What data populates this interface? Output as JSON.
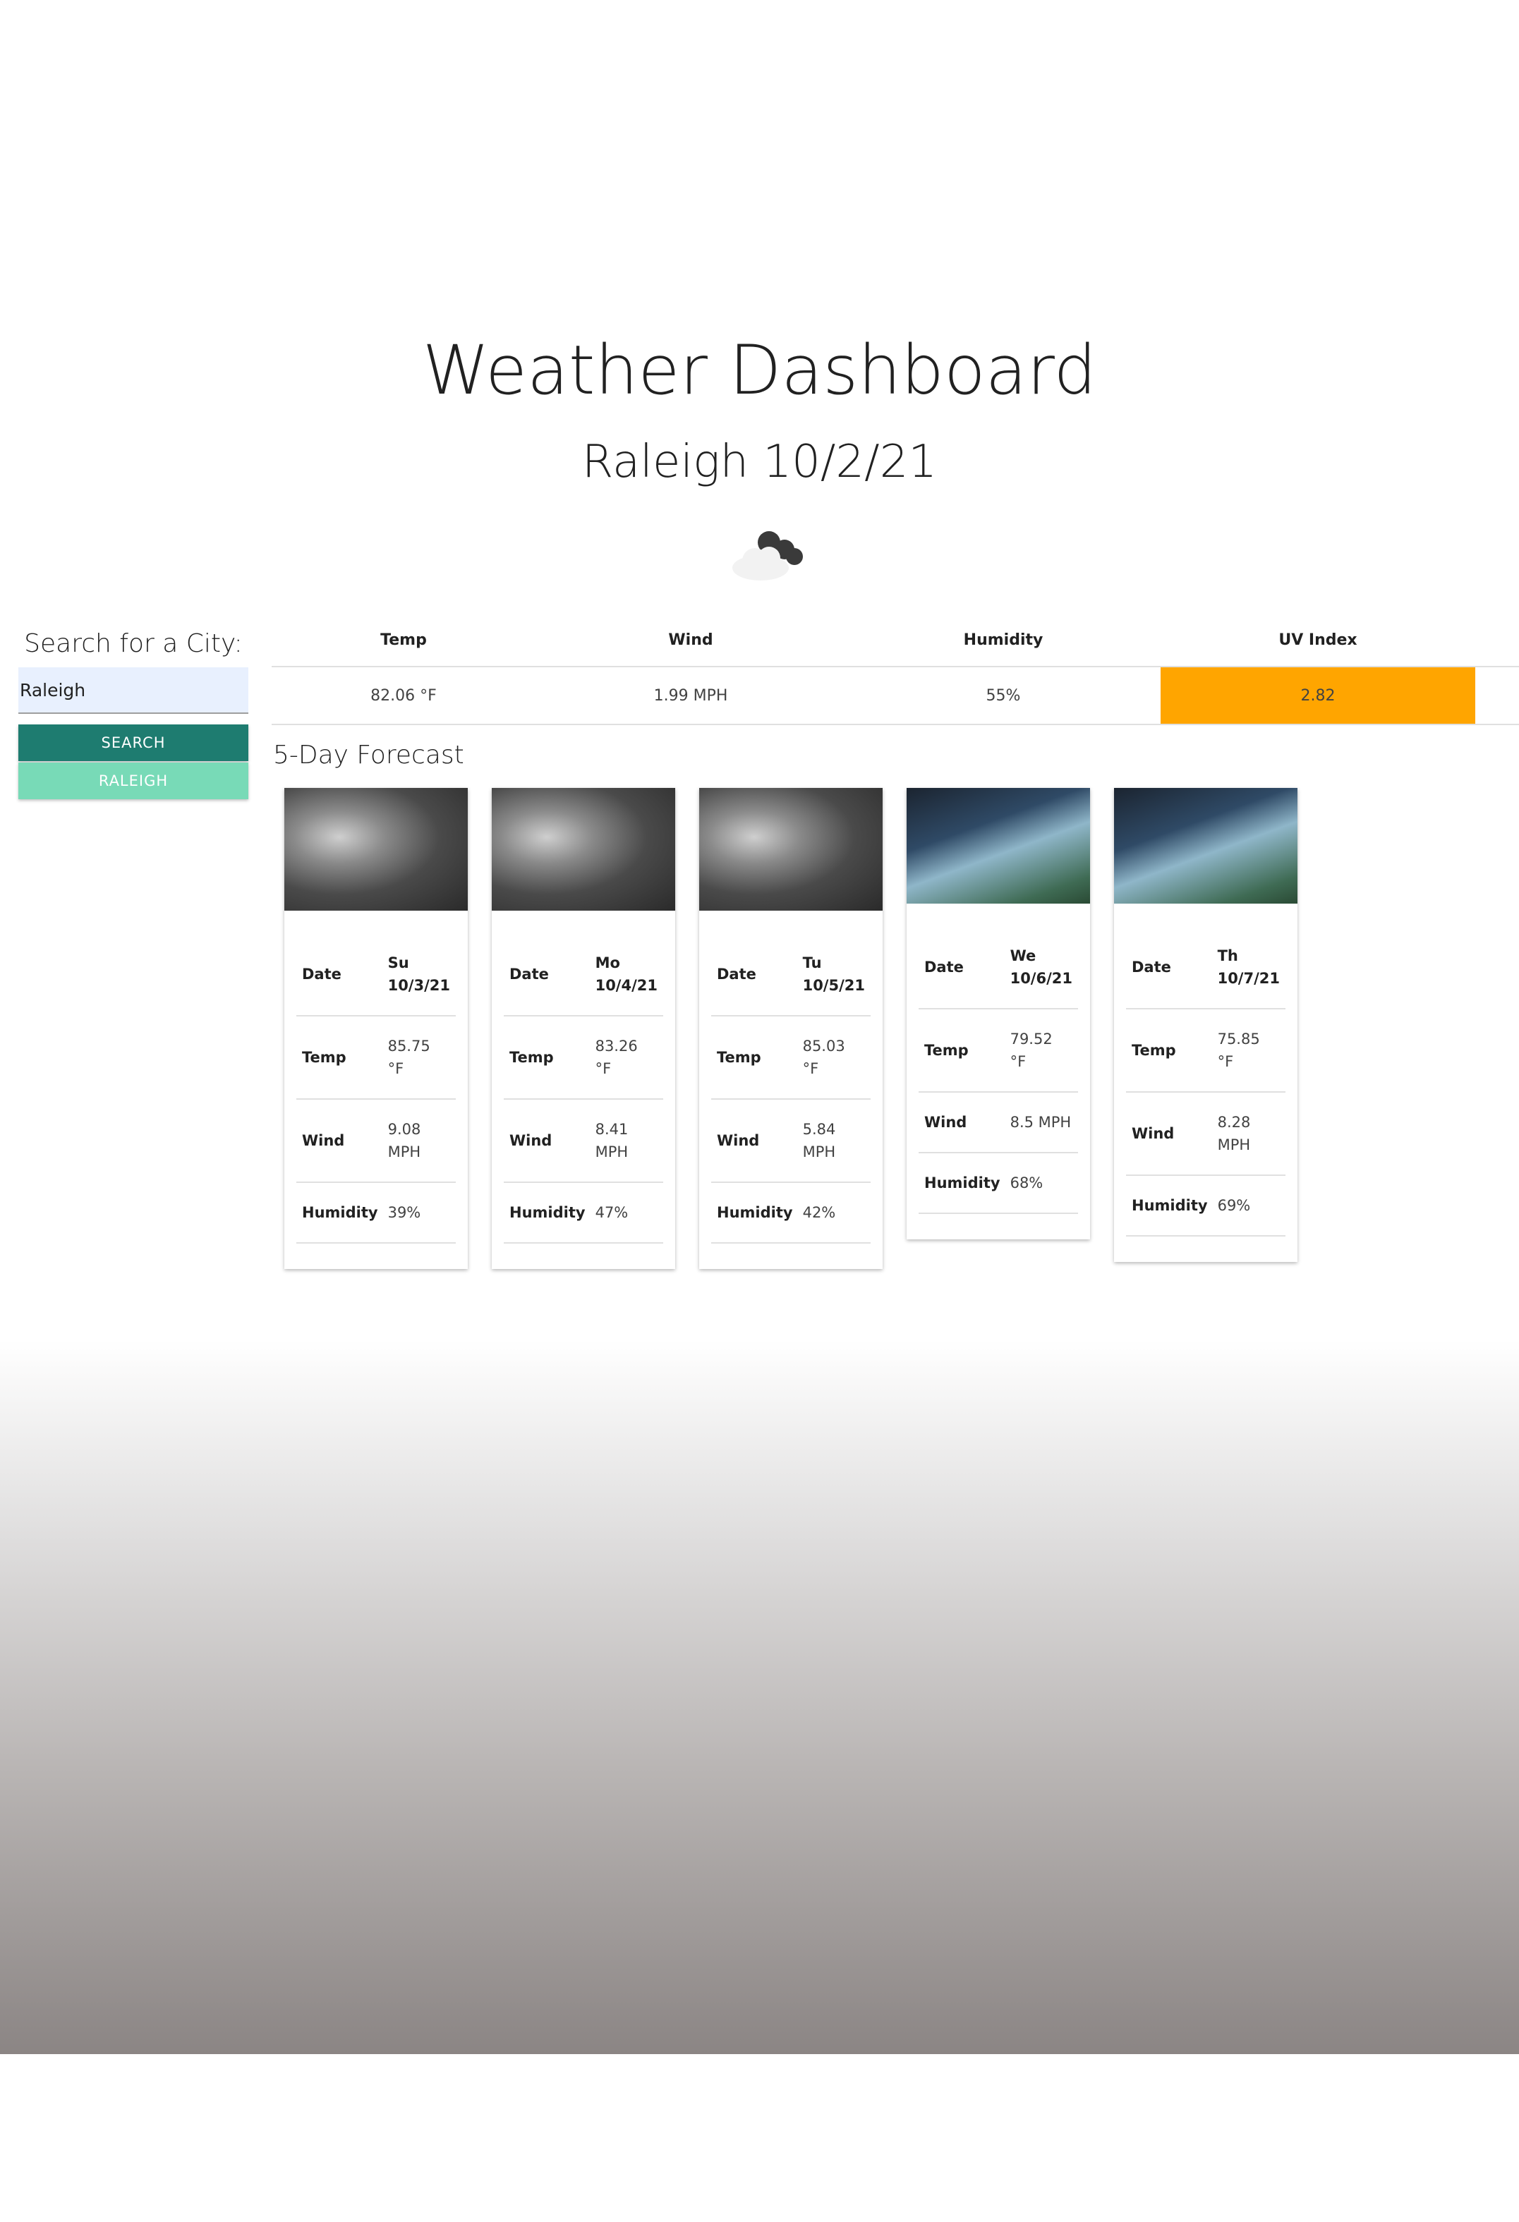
{
  "header": {
    "title": "Weather Dashboard",
    "subtitle": "Raleigh 10/2/21",
    "icon": "cloudy-night-icon"
  },
  "sidebar": {
    "heading": "Search for a City:",
    "search_value": "Raleigh",
    "search_button": "SEARCH",
    "history": [
      "RALEIGH"
    ]
  },
  "current": {
    "headers": [
      "Temp",
      "Wind",
      "Humidity",
      "UV Index"
    ],
    "values": [
      "82.06 °F",
      "1.99 MPH",
      "55%",
      "2.82"
    ],
    "uv_color": "#ffa500"
  },
  "forecast": {
    "heading": "5-Day Forecast",
    "row_labels": {
      "date": "Date",
      "temp": "Temp",
      "wind": "Wind",
      "humidity": "Humidity"
    },
    "days": [
      {
        "day": "Su",
        "date": "10/3/21",
        "temp": "85.75 °F",
        "wind": "9.08 MPH",
        "humidity": "39%",
        "image": "storm-clouds"
      },
      {
        "day": "Mo",
        "date": "10/4/21",
        "temp": "83.26 °F",
        "wind": "8.41 MPH",
        "humidity": "47%",
        "image": "storm-clouds"
      },
      {
        "day": "Tu",
        "date": "10/5/21",
        "temp": "85.03 °F",
        "wind": "5.84 MPH",
        "humidity": "42%",
        "image": "storm-clouds"
      },
      {
        "day": "We",
        "date": "10/6/21",
        "temp": "79.52 °F",
        "wind": "8.5 MPH",
        "humidity": "68%",
        "image": "umbrella-rain"
      },
      {
        "day": "Th",
        "date": "10/7/21",
        "temp": "75.85 °F",
        "wind": "8.28 MPH",
        "humidity": "69%",
        "image": "umbrella-rain"
      }
    ]
  }
}
